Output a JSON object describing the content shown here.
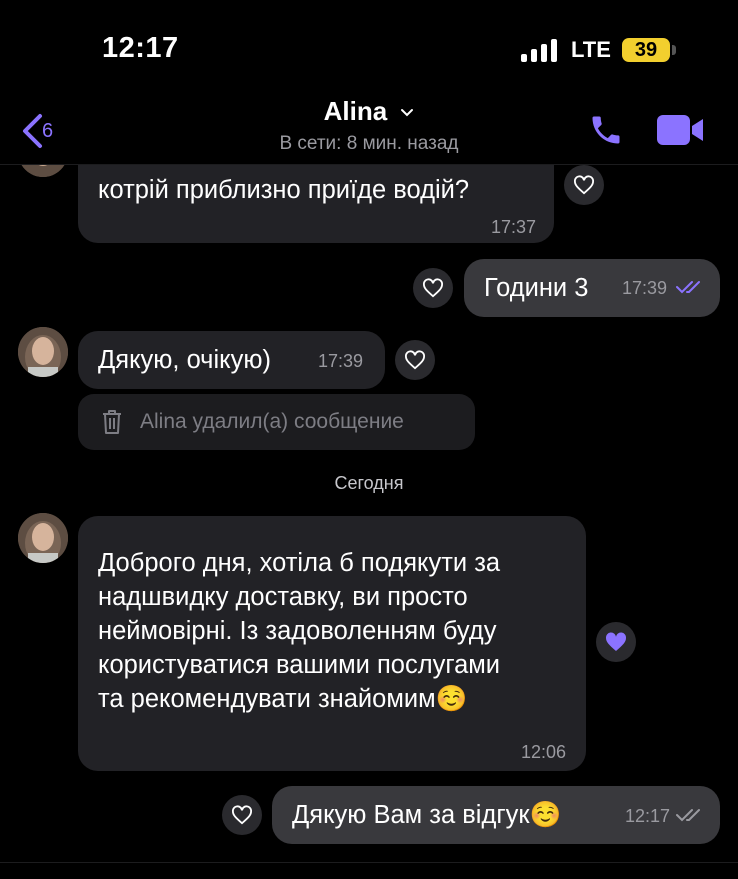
{
  "status_bar": {
    "time": "12:17",
    "network": "LTE",
    "battery": "39"
  },
  "header": {
    "back_count": "6",
    "contact_name": "Alina",
    "presence": "В сети: 8 мин. назад"
  },
  "colors": {
    "accent": "#8b73ff",
    "incoming_bubble": "#222226",
    "outgoing_bubble": "#39393d"
  },
  "messages": {
    "m1": {
      "text_line1": "…",
      "text_line2": "котрій приблизно приїде водій?",
      "time": "17:37"
    },
    "m2": {
      "text": "Години 3",
      "time": "17:39"
    },
    "m3": {
      "text": "Дякую, очікую)",
      "time": "17:39"
    },
    "deleted": {
      "text": "Alina удалил(а) сообщение"
    },
    "date_separator": "Сегодня",
    "m4": {
      "line1": "Доброго дня, хотіла б подякути за",
      "line2": "надшвидку доставку, ви просто",
      "line3": "неймовірні. Із задоволенням буду",
      "line4": "користуватися вашими послугами",
      "line5": "та рекомендувати знайомим☺️",
      "time": "12:06",
      "liked": true
    },
    "m5": {
      "text": "Дякую Вам за відгук☺️",
      "time": "12:17"
    }
  }
}
